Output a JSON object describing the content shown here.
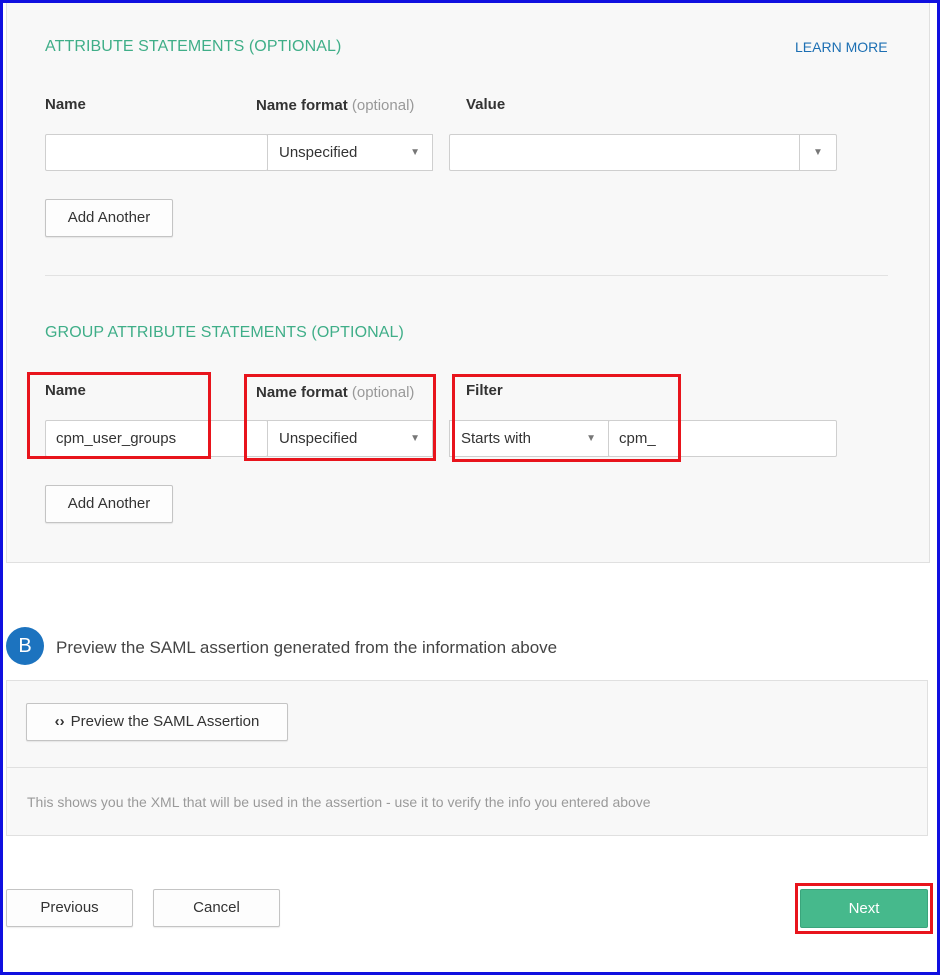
{
  "attribute_statements": {
    "heading": "ATTRIBUTE STATEMENTS (OPTIONAL)",
    "learn_more": "LEARN MORE",
    "name_label": "Name",
    "name_format_label": "Name format",
    "optional_tag": "(optional)",
    "value_label": "Value",
    "name_value": "",
    "name_format_value": "Unspecified",
    "value_value": "",
    "add_another": "Add Another"
  },
  "group_attribute_statements": {
    "heading": "GROUP ATTRIBUTE STATEMENTS (OPTIONAL)",
    "name_label": "Name",
    "name_format_label": "Name format",
    "optional_tag": "(optional)",
    "filter_label": "Filter",
    "name_value": "cpm_user_groups",
    "name_format_value": "Unspecified",
    "filter_type_value": "Starts with",
    "filter_value": "cpm_",
    "add_another": "Add Another"
  },
  "preview": {
    "step_letter": "B",
    "step_text": "Preview the SAML assertion generated from the information above",
    "button_icon": "code-icon",
    "button_label": "Preview the SAML Assertion",
    "note": "This shows you the XML that will be used in the assertion - use it to verify the info you entered above"
  },
  "footer": {
    "previous": "Previous",
    "cancel": "Cancel",
    "next": "Next"
  },
  "colors": {
    "heading_green": "#3fae88",
    "link_blue": "#1c6fb3",
    "step_blue": "#1c73bf",
    "next_green": "#46b98c",
    "highlight_red": "#e8141c",
    "frame_blue": "#1010e0"
  }
}
